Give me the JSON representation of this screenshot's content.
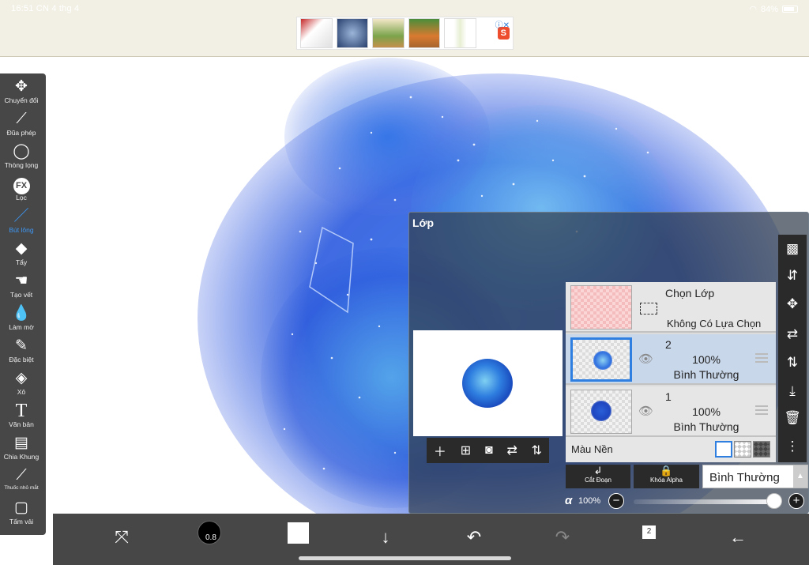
{
  "status": {
    "time": "16:51",
    "date": "CN 4 thg 4",
    "battery": "84%"
  },
  "ad": {
    "close": "ⓘ✕",
    "shop": "S"
  },
  "toolbar": {
    "tools": [
      {
        "label": "Chuyển đổi",
        "icon": "move-icon"
      },
      {
        "label": "Đũa phép",
        "icon": "magic-wand-icon"
      },
      {
        "label": "Thòng lọng",
        "icon": "lasso-icon"
      },
      {
        "label": "Lọc",
        "icon": "fx-icon",
        "glyph": "FX"
      },
      {
        "label": "Bút lông",
        "icon": "brush-icon",
        "active": true
      },
      {
        "label": "Tẩy",
        "icon": "eraser-icon"
      },
      {
        "label": "Tạo vết",
        "icon": "smudge-icon"
      },
      {
        "label": "Làm mờ",
        "icon": "blur-icon"
      },
      {
        "label": "Đặc biệt",
        "icon": "special-icon"
      },
      {
        "label": "Xô",
        "icon": "bucket-icon"
      },
      {
        "label": "Văn bản",
        "icon": "text-icon",
        "glyph": "T"
      },
      {
        "label": "Chia Khung",
        "icon": "frame-divide-icon"
      },
      {
        "label": "Thuốc nhỏ mắt",
        "icon": "eyedropper-icon"
      },
      {
        "label": "Tấm vải",
        "icon": "canvas-icon"
      }
    ]
  },
  "bottombar": {
    "brush_size": "0.8",
    "layer_count": "2"
  },
  "layers_panel": {
    "title": "Lớp",
    "selection_layer": {
      "title": "Chọn Lớp",
      "subtitle": "Không Có Lựa Chọn"
    },
    "layers": [
      {
        "number": "2",
        "opacity": "100%",
        "mode": "Bình Thường",
        "selected": true
      },
      {
        "number": "1",
        "opacity": "100%",
        "mode": "Bình Thường",
        "selected": false
      }
    ],
    "background": {
      "label": "Màu Nền"
    },
    "cut_button": "Cắt Đoạn",
    "alpha_lock_button": "Khóa Alpha",
    "blend_mode": "Bình Thường",
    "alpha_symbol": "α",
    "opacity": "100%",
    "minus": "−",
    "plus": "+"
  }
}
